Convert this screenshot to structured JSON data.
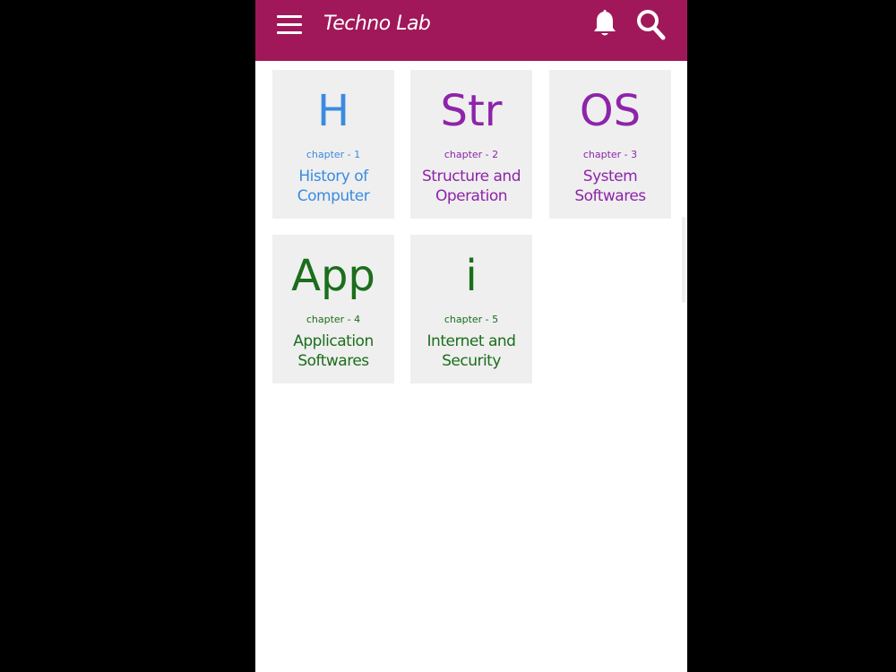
{
  "app_bar": {
    "title": "Techno Lab",
    "background_color": "#a0185a",
    "icons": [
      "menu-icon",
      "bell-icon",
      "search-icon"
    ]
  },
  "chapters": [
    {
      "abbr": "H",
      "chapter_label": "chapter - 1",
      "title_line1": "History of",
      "title_line2": "Computer",
      "color": "#3a8be0"
    },
    {
      "abbr": "Str",
      "chapter_label": "chapter - 2",
      "title_line1": "Structure and",
      "title_line2": "Operation",
      "color": "#8e24aa"
    },
    {
      "abbr": "OS",
      "chapter_label": "chapter - 3",
      "title_line1": "System",
      "title_line2": "Softwares",
      "color": "#8e24aa"
    },
    {
      "abbr": "App",
      "chapter_label": "chapter - 4",
      "title_line1": "Application",
      "title_line2": "Softwares",
      "color": "#1b6e1b"
    },
    {
      "abbr": "i",
      "chapter_label": "chapter - 5",
      "title_line1": "Internet and",
      "title_line2": "Security",
      "color": "#1b6e1b"
    }
  ]
}
